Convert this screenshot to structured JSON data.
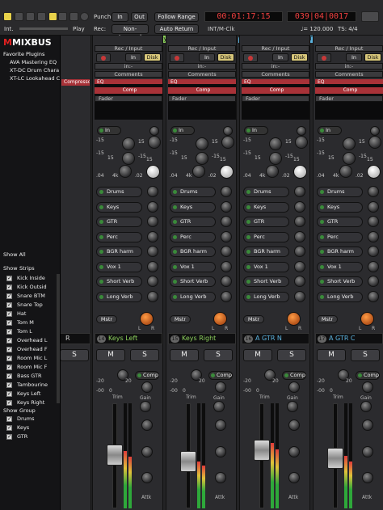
{
  "toolbar": {
    "int_label": "Int.",
    "play_label": "Play",
    "punch_label": "Punch:",
    "punch_in": "In",
    "punch_out": "Out",
    "rec_label": "Rec:",
    "rec_mode": "Non-Layered",
    "follow_range": "Follow Range",
    "auto_return": "Auto Return",
    "clock_primary": "00:01:17:15",
    "clock_secondary": "039|04|0017",
    "intm_clk": "INT/M-Clk",
    "tempo": "♩= 120.000",
    "time_sig": "TS: 4/4"
  },
  "sidebar": {
    "logo_mark": "M",
    "logo_text": "MIXBUS",
    "favorite_plugins_title": "Favorite Plugins",
    "plugins": [
      "AVA Mastering EQ",
      "XT-DC Drum Chara",
      "XT-LC Lookahead C"
    ],
    "show_all_label": "Show All",
    "strips_show_label": "Show",
    "strips_col_label": "Strips",
    "strips": [
      "Kick Inside",
      "Kick Outsid",
      "Snare BTM",
      "Snare Top",
      "Hat",
      "Tom M",
      "Tom L",
      "Overhead L",
      "Overhead F",
      "Room Mic L",
      "Room Mic F",
      "Bass GTR",
      "Tambourine",
      "Keys Left",
      "Keys Right"
    ],
    "groups_show_label": "Show",
    "groups_col_label": "Group",
    "groups": [
      "Drums",
      "Keys",
      "GTR"
    ]
  },
  "mixer": {
    "groups": [
      {
        "label": "Keys",
        "color": "#8cd05c"
      },
      {
        "label": "GTR",
        "color": "#5cb4e0"
      }
    ],
    "rec_input_label": "Rec / Input",
    "in_label": "In",
    "disk_label": "Disk",
    "in_dash": "in:-",
    "comments_label": "Comments",
    "eq_label": "EQ",
    "comp_label": "Comp",
    "fader_label": "Fader",
    "compressor_label": "Compressor",
    "xt_eq_label": "XT-EQ Equalizer (Mono)",
    "in_button": "In",
    "eq_values": {
      "a": "-15",
      "b": "15",
      "c": "-15",
      "d": "15",
      "e": "-15",
      "f": "15",
      "g": ".04",
      "h": "4k",
      "i": ".02",
      "j": "4k",
      "k": ".1"
    },
    "sends": [
      "Drums",
      "Keys",
      "GTR",
      "Perc",
      "BGR harm",
      "Vox 1",
      "Short Verb",
      "Long Verb"
    ],
    "mstr_label": "Mstr",
    "pan_l": "L",
    "pan_r": "R",
    "strips": [
      {
        "num": "14",
        "name": "Keys Left",
        "name_color": "#8cd05c"
      },
      {
        "num": "15",
        "name": "Keys Right",
        "name_color": "#8cd05c"
      },
      {
        "num": "16",
        "name": "A GTR N",
        "name_color": "#5cb4e0"
      },
      {
        "num": "17",
        "name": "A GTR C",
        "name_color": "#5cb4e0"
      }
    ],
    "partial_name": "R",
    "m_label": "M",
    "s_label": "S",
    "comp_button": "Comp",
    "trim_label": "Trim",
    "gain_label": "Gain",
    "attk_label": "Attk",
    "scale": {
      "s_20": "-20",
      "s_0": "0",
      "s_20b": "20",
      "s_00": "-00"
    },
    "fader_levels": [
      0.55,
      0.45,
      0.62,
      0.5
    ]
  }
}
